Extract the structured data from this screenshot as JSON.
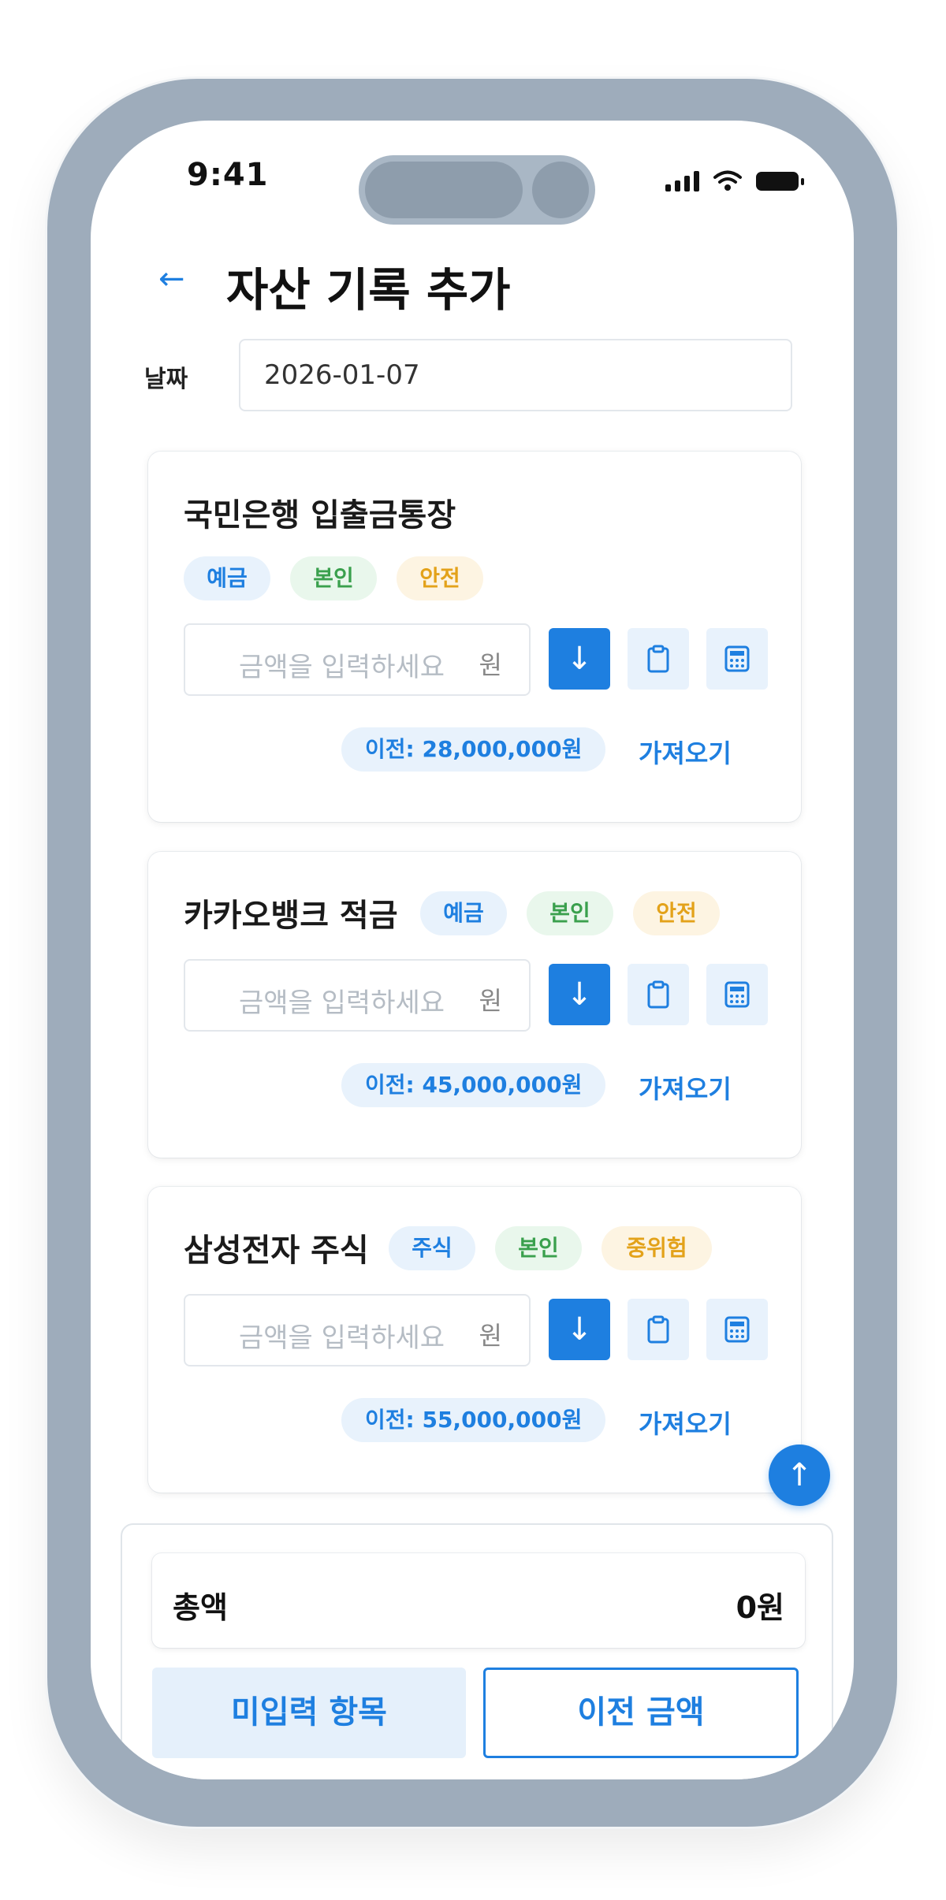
{
  "status_bar": {
    "time": "9:41"
  },
  "header": {
    "back_icon": "←",
    "title": "자산 기록 추가"
  },
  "date": {
    "label": "날짜",
    "value": "2026-01-07"
  },
  "assets": [
    {
      "name": "국민은행 입출금통장",
      "tags": [
        "예금",
        "본인",
        "안전"
      ],
      "amount_placeholder": "금액을 입력하세요",
      "unit": "원",
      "previous": "이전: 28,000,000원",
      "fetch_label": "가져오기"
    },
    {
      "name": "카카오뱅크 적금",
      "tags": [
        "예금",
        "본인",
        "안전"
      ],
      "amount_placeholder": "금액을 입력하세요",
      "unit": "원",
      "previous": "이전: 45,000,000원",
      "fetch_label": "가져오기"
    },
    {
      "name": "삼성전자 주식",
      "tags": [
        "주식",
        "본인",
        "중위험"
      ],
      "amount_placeholder": "금액을 입력하세요",
      "unit": "원",
      "previous": "이전: 55,000,000원",
      "fetch_label": "가져오기"
    }
  ],
  "icons": {
    "down": "↓",
    "up": "↑",
    "clipboard": "clipboard-icon",
    "calculator": "calculator-icon"
  },
  "summary": {
    "total_label": "총액",
    "total_value": "0원"
  },
  "actions": {
    "missing_items": "미입력 항목",
    "previous_amount": "이전 금액"
  },
  "colors": {
    "accent": "#1e7fe0",
    "frame": "#9eacbb"
  }
}
